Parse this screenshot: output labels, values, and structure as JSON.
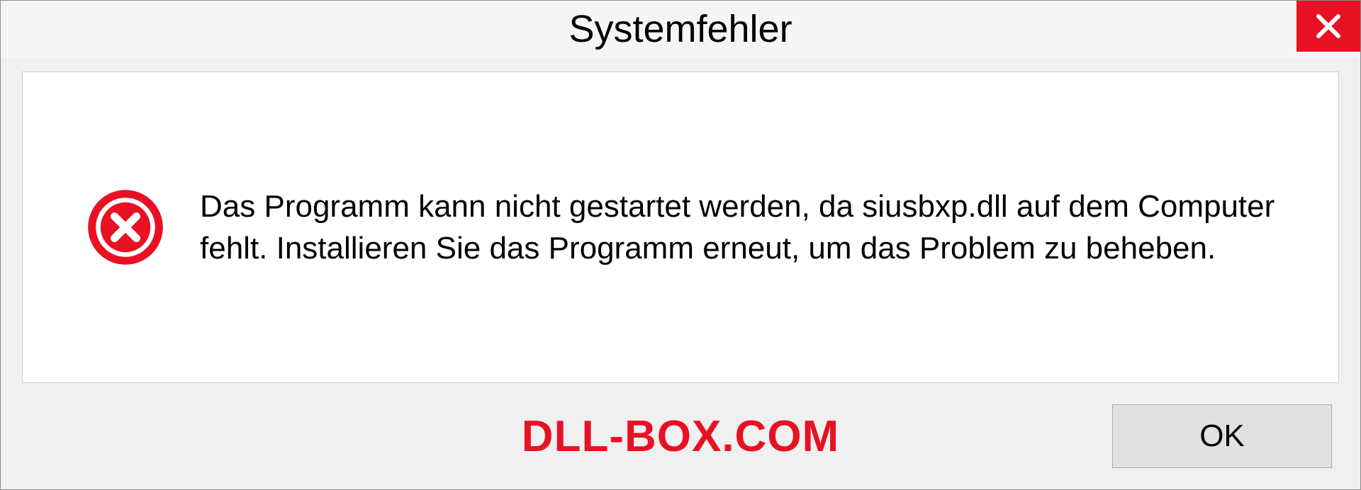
{
  "dialog": {
    "title": "Systemfehler",
    "message": "Das Programm kann nicht gestartet werden, da siusbxp.dll auf dem Computer fehlt. Installieren Sie das Programm erneut, um das Problem zu beheben.",
    "ok_label": "OK",
    "watermark": "DLL-BOX.COM"
  }
}
